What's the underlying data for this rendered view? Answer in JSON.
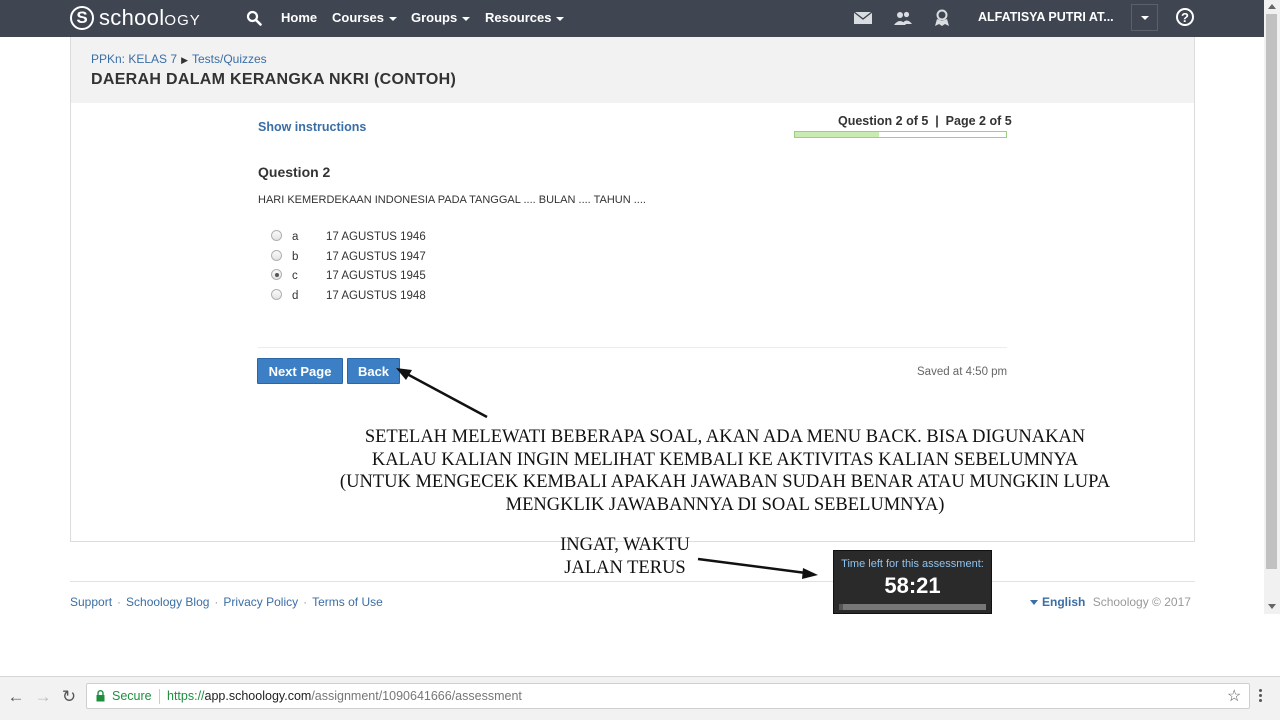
{
  "nav": {
    "logo_prefix": "school",
    "logo_suffix": "OGY",
    "items": [
      {
        "label": "Home"
      },
      {
        "label": "Courses"
      },
      {
        "label": "Groups"
      },
      {
        "label": "Resources"
      }
    ],
    "icons": [
      "search-icon",
      "mail-icon",
      "people-icon",
      "notification-icon",
      "help-icon"
    ],
    "user_name": "ALFATISYA PUTRI AT...",
    "help_glyph": "?"
  },
  "breadcrumb": {
    "course": "PPKn: KELAS 7",
    "section": "Tests/Quizzes"
  },
  "page_title": "DAERAH DALAM KERANGKA NKRI (CONTOH)",
  "quiz": {
    "show_instructions": "Show instructions",
    "progress_label": "Question 2 of 5  |  Page 2 of 5",
    "progress_fraction": 0.4,
    "question_title": "Question 2",
    "question_text": "HARI KEMERDEKAAN INDONESIA PADA TANGGAL .... BULAN .... TAHUN ....",
    "choices": [
      {
        "letter": "a",
        "text": "17 AGUSTUS 1946",
        "selected": false
      },
      {
        "letter": "b",
        "text": "17 AGUSTUS 1947",
        "selected": false
      },
      {
        "letter": "c",
        "text": "17 AGUSTUS 1945",
        "selected": true
      },
      {
        "letter": "d",
        "text": "17 AGUSTUS 1948",
        "selected": false
      }
    ],
    "next_label": "Next Page",
    "back_label": "Back",
    "saved_text": "Saved at 4:50 pm"
  },
  "annotations": {
    "back_note": [
      "SETELAH MELEWATI BEBERAPA SOAL, AKAN ADA MENU BACK. BISA DIGUNAKAN",
      "KALAU KALIAN INGIN MELIHAT KEMBALI KE AKTIVITAS KALIAN SEBELUMNYA",
      "(UNTUK MENGECEK KEMBALI APAKAH JAWABAN SUDAH BENAR ATAU MUNGKIN LUPA",
      "MENGKLIK JAWABANNYA DI SOAL SEBELUMNYA)"
    ],
    "timer_note": [
      "INGAT, WAKTU",
      "JALAN TERUS"
    ]
  },
  "timer": {
    "label": "Time left for this assessment:",
    "value": "58:21",
    "fraction_elapsed": 0.03
  },
  "footer": {
    "links": [
      "Support",
      "Schoology Blog",
      "Privacy Policy",
      "Terms of Use"
    ],
    "language": "English",
    "copyright": "Schoology © 2017"
  },
  "browser": {
    "secure_label": "Secure",
    "url_scheme": "https://",
    "url_host": "app.schoology.com",
    "url_path": "/assignment/1090641666/assessment"
  },
  "colors": {
    "nav_bg": "#3f4652",
    "link_blue": "#3a6ea5",
    "button_blue": "#3d7fc4",
    "progress_green": "#c9eab1",
    "secure_green": "#1e8e3e"
  }
}
